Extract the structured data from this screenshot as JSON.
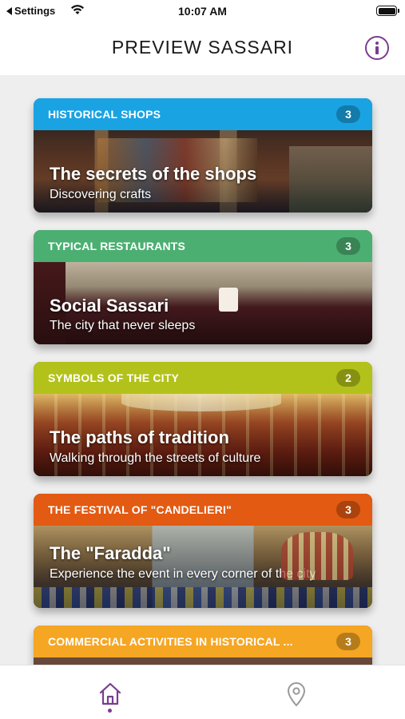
{
  "status_bar": {
    "back_label": "Settings",
    "time": "10:07 AM"
  },
  "nav": {
    "title": "PREVIEW SASSARI",
    "info_icon": "info-icon"
  },
  "colors": {
    "accent": "#7a3d8f",
    "background": "#eeeeee"
  },
  "cards": [
    {
      "category": "HISTORICAL SHOPS",
      "count": "3",
      "title": "The secrets of the shops",
      "subtitle": "Discovering crafts",
      "header_color": "#1aa3e3"
    },
    {
      "category": "TYPICAL RESTAURANTS",
      "count": "3",
      "title": "Social Sassari",
      "subtitle": "The city that never sleeps",
      "header_color": "#4caf72"
    },
    {
      "category": "SYMBOLS OF THE CITY",
      "count": "2",
      "title": "The paths of tradition",
      "subtitle": "Walking through the streets of culture",
      "header_color": "#b3c21a"
    },
    {
      "category": "THE FESTIVAL OF \"CANDELIERI\"",
      "count": "3",
      "title": "The \"Faradda\"",
      "subtitle": "Experience the event in every corner of the city",
      "header_color": "#e35a12"
    },
    {
      "category": "COMMERCIAL ACTIVITIES IN HISTORICAL ...",
      "count": "3",
      "title": "",
      "subtitle": "",
      "header_color": "#f5a623"
    }
  ],
  "tab_bar": {
    "items": [
      {
        "icon": "home-icon",
        "selected": true
      },
      {
        "icon": "map-pin-icon",
        "selected": false
      }
    ]
  }
}
